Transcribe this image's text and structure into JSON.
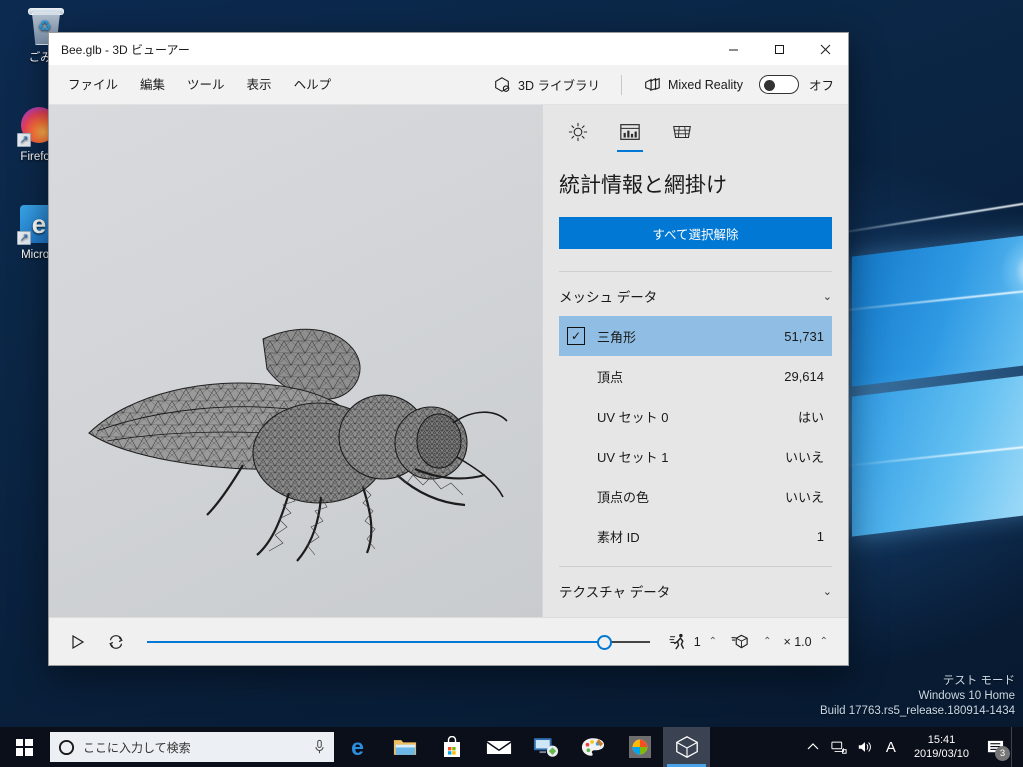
{
  "desktop": {
    "icons": [
      {
        "name": "recycle-bin",
        "label": "ごみ箱"
      },
      {
        "name": "firefox",
        "label": "Firefox"
      },
      {
        "name": "microsoft-edge",
        "label": "Micros"
      }
    ],
    "watermark": {
      "line1": "テスト モード",
      "line2": "Windows 10 Home",
      "line3": "Build 17763.rs5_release.180914-1434"
    }
  },
  "window": {
    "title": "Bee.glb - 3D ビューアー",
    "controls": {
      "minimize": "—",
      "maximize": "☐",
      "close": "✕"
    },
    "menu": [
      "ファイル",
      "編集",
      "ツール",
      "表示",
      "ヘルプ"
    ],
    "toolbar": {
      "library_label": "3D ライブラリ",
      "mixed_reality_label": "Mixed Reality",
      "mixed_reality_state": "オフ"
    }
  },
  "panel": {
    "tabs": [
      {
        "icon": "lighting-icon",
        "label": "照明",
        "active": false
      },
      {
        "icon": "statistics-icon",
        "label": "統計",
        "active": true
      },
      {
        "icon": "wireframe-icon",
        "label": "網掛け",
        "active": false
      }
    ],
    "title": "統計情報と網掛け",
    "deselect_all": "すべて選択解除",
    "sections": [
      {
        "name": "mesh-data",
        "header": "メッシュ データ",
        "expanded": true,
        "rows": [
          {
            "label": "三角形",
            "value": "51,731",
            "selected": true,
            "checkbox": true
          },
          {
            "label": "頂点",
            "value": "29,614",
            "selected": false,
            "checkbox": false
          },
          {
            "label": "UV セット 0",
            "value": "はい",
            "selected": false,
            "checkbox": false
          },
          {
            "label": "UV セット 1",
            "value": "いいえ",
            "selected": false,
            "checkbox": false
          },
          {
            "label": "頂点の色",
            "value": "いいえ",
            "selected": false,
            "checkbox": false
          },
          {
            "label": "素材 ID",
            "value": "1",
            "selected": false,
            "checkbox": false
          }
        ]
      },
      {
        "name": "texture-data",
        "header": "テクスチャ データ",
        "expanded": false,
        "rows": []
      }
    ]
  },
  "playback": {
    "play_label": "再生",
    "loop_label": "ループ",
    "slider_position_percent": 91,
    "animation_count": "1",
    "model_label": "",
    "speed": "× 1.0"
  },
  "taskbar": {
    "search_placeholder": "ここに入力して検索",
    "apps": [
      {
        "name": "microsoft-edge",
        "glyph": "e",
        "active": false
      },
      {
        "name": "file-explorer",
        "glyph": "🗀",
        "active": false
      },
      {
        "name": "microsoft-store",
        "glyph": "🛍",
        "active": false
      },
      {
        "name": "mail",
        "glyph": "✉",
        "active": false
      },
      {
        "name": "remote-desktop",
        "glyph": "🖥",
        "active": false
      },
      {
        "name": "paint-3d",
        "glyph": "🎨",
        "active": false
      },
      {
        "name": "photos",
        "glyph": "◕",
        "active": false
      },
      {
        "name": "3d-viewer",
        "glyph": "⬡",
        "active": true
      }
    ],
    "tray": {
      "chevron": "⌃",
      "network": "network-icon",
      "volume": "volume-icon",
      "ime": "A",
      "time": "15:41",
      "date": "2019/03/10",
      "notification_count": "3"
    }
  },
  "colors": {
    "accent": "#0078d4",
    "selection": "#8fbde4",
    "panel_bg": "#e6e6e6",
    "taskbar": "#0b0f19"
  }
}
